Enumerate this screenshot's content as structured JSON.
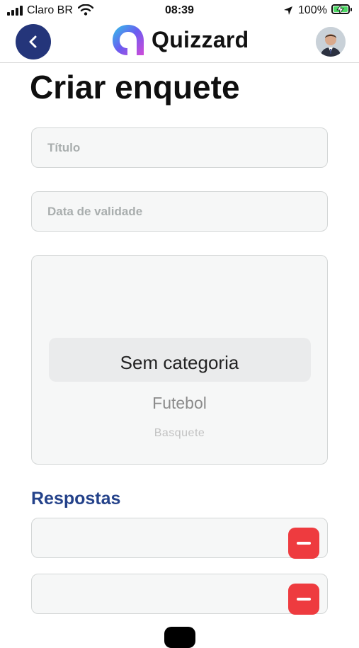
{
  "status_bar": {
    "carrier": "Claro BR",
    "time": "08:39",
    "battery": "100%",
    "icons": [
      "signal-icon",
      "wifi-icon",
      "location-icon",
      "battery-charging-icon"
    ]
  },
  "header": {
    "back_icon": "chevron-left-icon",
    "app_name": "Quizzard",
    "logo_icon": "quizzard-logo-icon"
  },
  "page": {
    "title": "Criar enquete"
  },
  "form": {
    "title_placeholder": "Título",
    "validity_placeholder": "Data de validade",
    "category": {
      "selected": "Sem categoria",
      "options": [
        "Sem categoria",
        "Futebol",
        "Basquete"
      ]
    }
  },
  "answers": {
    "section_label": "Respostas",
    "items": [
      {
        "value": "",
        "remove_icon": "minus-icon"
      },
      {
        "value": "",
        "remove_icon": "minus-icon"
      }
    ]
  },
  "colors": {
    "primary": "#24357a",
    "section_label": "#24428a",
    "remove": "#ee3b3f",
    "field_bg": "#f6f7f7",
    "battery": "#4cd964"
  }
}
